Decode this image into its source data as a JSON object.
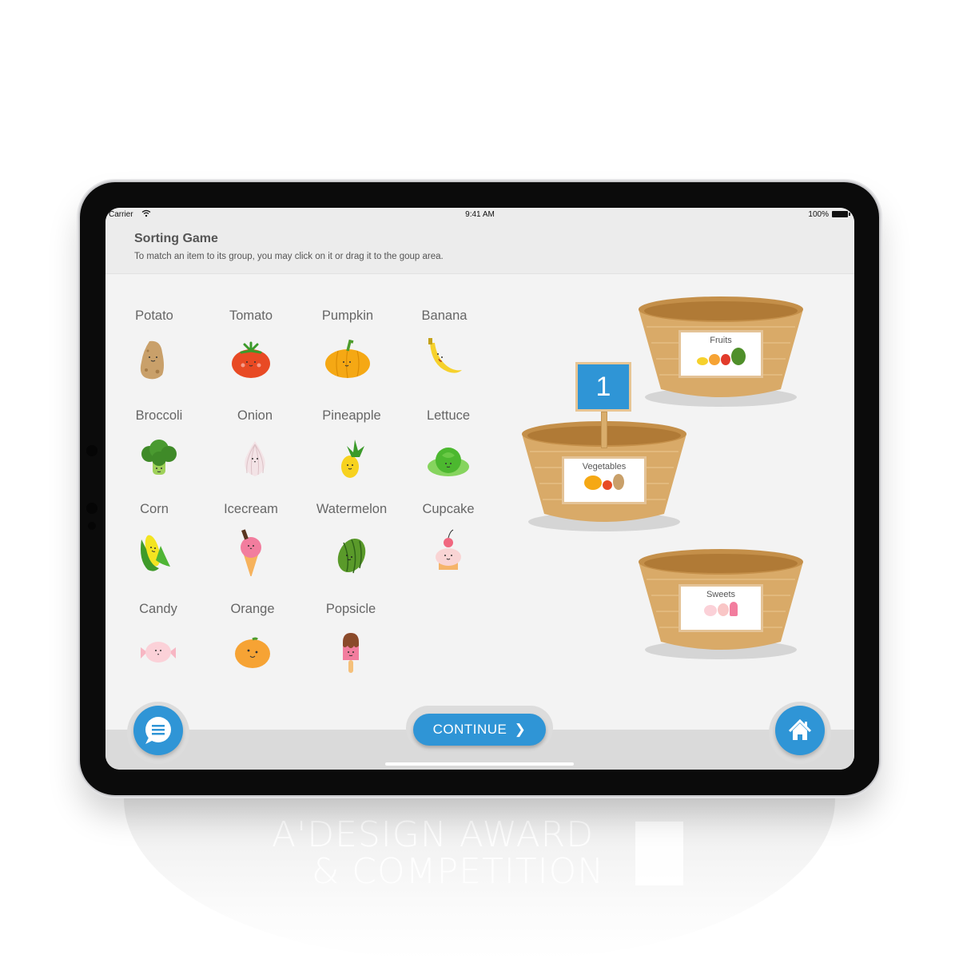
{
  "status_bar": {
    "carrier": "Carrier",
    "wifi_icon": "wifi-icon",
    "time": "9:41 AM",
    "battery_percent": "100%",
    "battery_icon": "battery-full-icon"
  },
  "header": {
    "title": "Sorting Game",
    "instructions": "To match an item to its group, you may click on it or drag it to the goup area."
  },
  "items": [
    {
      "label": "Potato",
      "icon": "potato-icon"
    },
    {
      "label": "Tomato",
      "icon": "tomato-icon"
    },
    {
      "label": "Pumpkin",
      "icon": "pumpkin-icon"
    },
    {
      "label": "Banana",
      "icon": "banana-icon"
    },
    {
      "label": "Broccoli",
      "icon": "broccoli-icon"
    },
    {
      "label": "Onion",
      "icon": "onion-icon"
    },
    {
      "label": "Pineapple",
      "icon": "pineapple-icon"
    },
    {
      "label": "Lettuce",
      "icon": "lettuce-icon"
    },
    {
      "label": "Corn",
      "icon": "corn-icon"
    },
    {
      "label": "Icecream",
      "icon": "icecream-icon"
    },
    {
      "label": "Watermelon",
      "icon": "watermelon-icon"
    },
    {
      "label": "Cupcake",
      "icon": "cupcake-icon"
    },
    {
      "label": "Candy",
      "icon": "candy-icon"
    },
    {
      "label": "Orange",
      "icon": "orange-icon"
    },
    {
      "label": "Popsicle",
      "icon": "popsicle-icon"
    }
  ],
  "groups": [
    {
      "label": "Fruits",
      "icon": "fruits-basket-icon"
    },
    {
      "label": "Vegetables",
      "icon": "vegetables-basket-icon",
      "counter": "1"
    },
    {
      "label": "Sweets",
      "icon": "sweets-basket-icon"
    }
  ],
  "footer": {
    "chat_icon": "chat-menu-icon",
    "continue_label": "CONTINUE",
    "continue_icon": "chevron-right-icon",
    "home_icon": "home-icon"
  },
  "watermark": {
    "line1": "A'DESIGN AWARD",
    "line2": "& COMPETITION"
  },
  "colors": {
    "accent": "#2f95d6",
    "background": "#f3f3f3",
    "header_bg": "#ececec",
    "basket": "#d9aa68"
  }
}
